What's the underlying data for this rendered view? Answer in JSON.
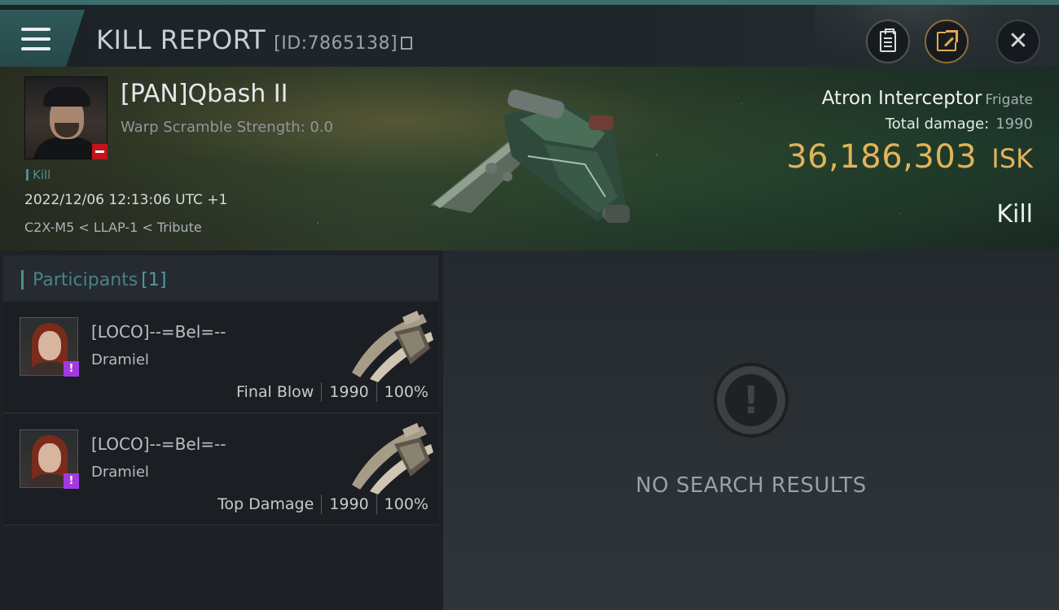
{
  "header": {
    "title": "KILL REPORT",
    "id_text": "[ID:7865138]"
  },
  "icons": {
    "menu": "hamburger-menu-icon",
    "report": "clipboard-icon",
    "share": "share-icon",
    "close": "close-icon",
    "copy": "copy-icon",
    "alert": "exclamation-icon"
  },
  "victim": {
    "name": "[PAN]Qbash II",
    "warp": "Warp Scramble Strength: 0.0",
    "tag": "Kill",
    "datetime": "2022/12/06 12:13:06 UTC +1",
    "location": "C2X-M5 < LLAP-1 < Tribute",
    "ship_name": "Atron Interceptor",
    "ship_class": "Frigate",
    "total_damage_label": "Total damage:",
    "total_damage": "1990",
    "isk_value": "36,186,303",
    "isk_unit": "ISK",
    "result": "Kill"
  },
  "participants": {
    "label": "Participants",
    "count": "[1]",
    "rows": [
      {
        "name": "[LOCO]--=Bel=--",
        "ship": "Dramiel",
        "role": "Final Blow",
        "damage": "1990",
        "percent": "100%"
      },
      {
        "name": "[LOCO]--=Bel=--",
        "ship": "Dramiel",
        "role": "Top Damage",
        "damage": "1990",
        "percent": "100%"
      }
    ]
  },
  "empty_state": {
    "text": "NO SEARCH RESULTS"
  },
  "colors": {
    "accent_teal": "#3b6e6c",
    "isk_gold": "#e2b358",
    "badge_red": "#c3141b",
    "badge_purple": "#a23ae0"
  }
}
